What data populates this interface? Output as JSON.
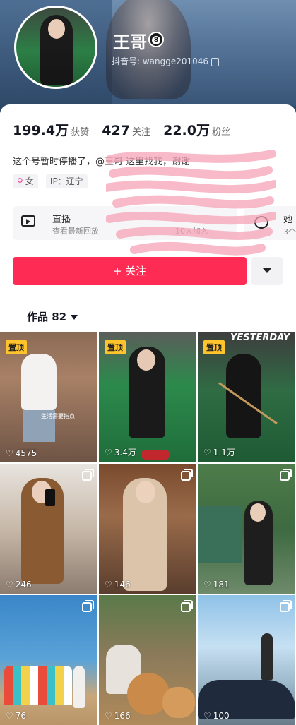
{
  "profile": {
    "name": "王哥",
    "badge": "8",
    "douyin_id": "抖音号: wangge201046"
  },
  "stats": [
    {
      "value": "199.4万",
      "label": "获赞"
    },
    {
      "value": "427",
      "label": "关注"
    },
    {
      "value": "22.0万",
      "label": "粉丝"
    }
  ],
  "bio": "这个号暂时停播了，@王哥 这里找我，谢谢",
  "tags": {
    "gender": "女",
    "ip": "IP：辽宁"
  },
  "live": {
    "title": "直播",
    "subtitle": "查看最新回放",
    "joined": "10人加入"
  },
  "group": {
    "title": "她",
    "subtitle": "3个"
  },
  "follow_label": "+ 关注",
  "works": {
    "label": "作品 82"
  },
  "videos": [
    {
      "pinned": "置顶",
      "likes": "4575",
      "caption": "生活需要指点"
    },
    {
      "pinned": "置顶",
      "likes": "3.4万"
    },
    {
      "pinned": "置顶",
      "likes": "1.1万",
      "caption": "YESTERDAY"
    },
    {
      "likes": "246"
    },
    {
      "likes": "146"
    },
    {
      "likes": "181"
    },
    {
      "likes": "76"
    },
    {
      "likes": "166"
    },
    {
      "likes": "100"
    }
  ]
}
